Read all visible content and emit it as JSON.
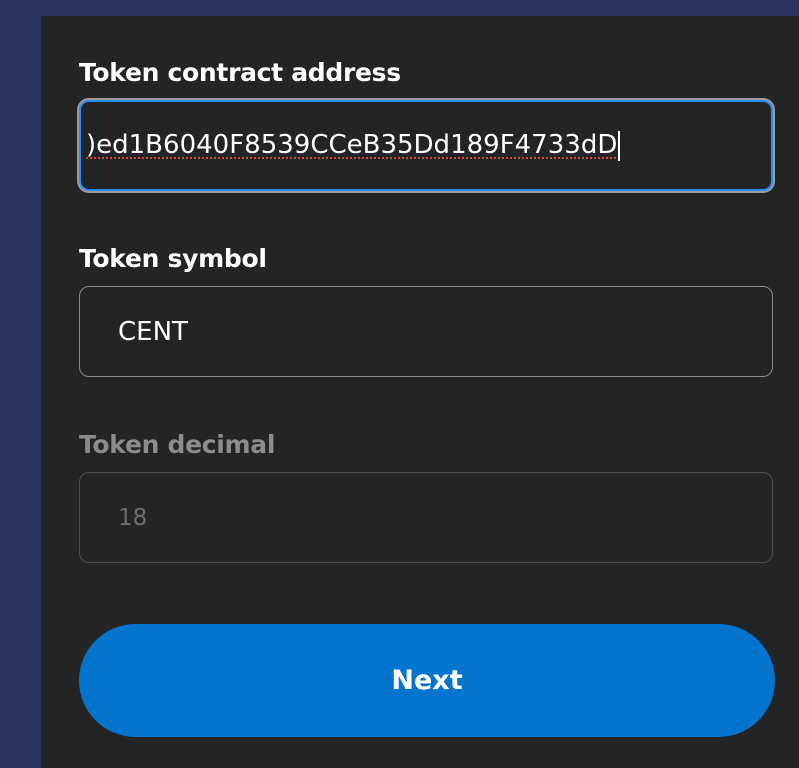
{
  "form": {
    "contract_address_label": "Token contract address",
    "contract_address_value": ")ed1B6040F8539CCeB35Dd189F4733dD",
    "symbol_label": "Token symbol",
    "symbol_value": "CENT",
    "decimal_label": "Token decimal",
    "decimal_placeholder": "18",
    "next_label": "Next"
  },
  "colors": {
    "background": "#2c3562",
    "panel": "#232426",
    "focus_border": "#2d8cf0",
    "button": "#0474cc"
  }
}
